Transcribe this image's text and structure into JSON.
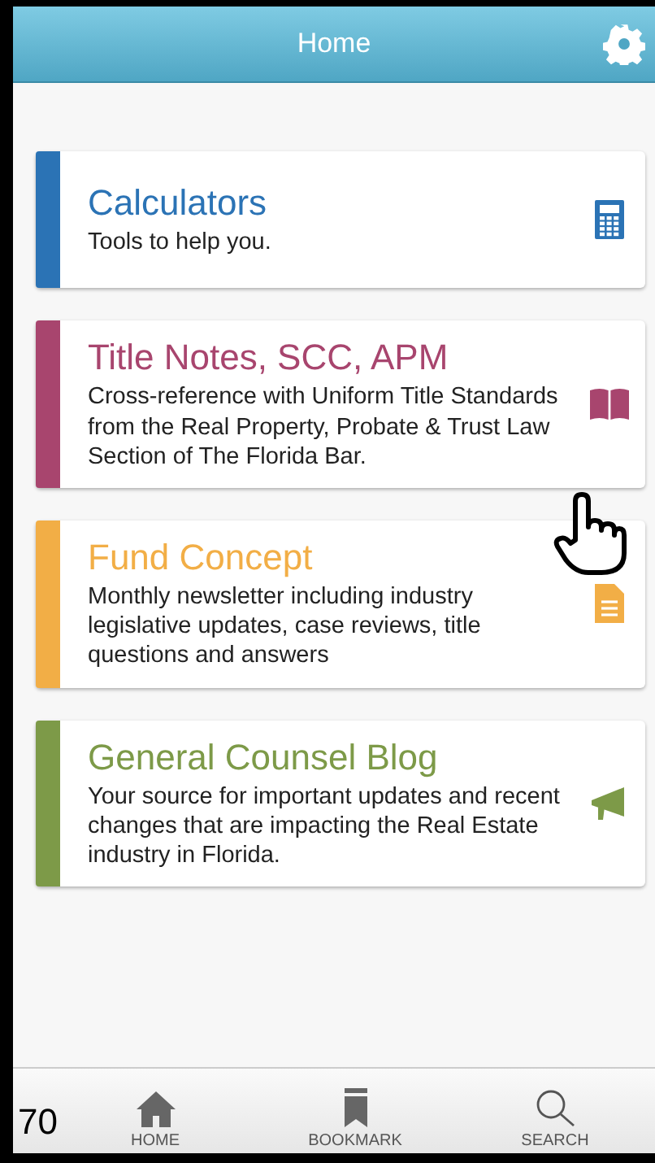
{
  "header": {
    "title": "Home"
  },
  "cards": [
    {
      "title": "Calculators",
      "description": "Tools to help you.",
      "color": "#2b73b5",
      "kind": "calculator"
    },
    {
      "title": "Title Notes, SCC, APM",
      "description": "Cross-reference with Uniform Title Standards from the Real Property, Probate & Trust Law Section of The Florida Bar.",
      "color": "#a8456e",
      "kind": "book"
    },
    {
      "title": "Fund Concept",
      "description": "Monthly newsletter including industry legislative updates, case reviews, title questions and answers",
      "color": "#f2ae46",
      "kind": "document"
    },
    {
      "title": "General Counsel Blog",
      "description": "Your source for important updates and recent changes that are impacting the Real Estate industry in Florida.",
      "color": "#7d9a48",
      "kind": "megaphone"
    }
  ],
  "tabs": [
    {
      "label": "HOME",
      "kind": "home"
    },
    {
      "label": "BOOKMARK",
      "kind": "bookmark"
    },
    {
      "label": "SEARCH",
      "kind": "search"
    }
  ],
  "page_number": "70"
}
